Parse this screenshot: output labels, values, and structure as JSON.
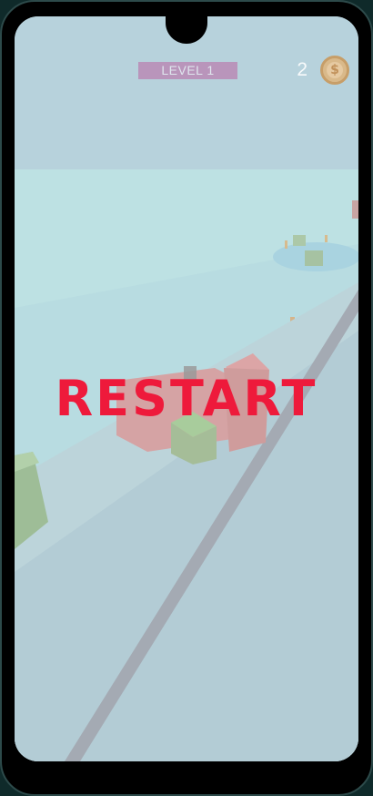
{
  "hud": {
    "level_label": "LEVEL 1",
    "coin_count": "2",
    "coin_icon": "dollar-coin-icon"
  },
  "overlay": {
    "restart_label": "RESTART"
  },
  "colors": {
    "sky": "#b7d2dc",
    "water": "#bde1e3",
    "track": "#c2d9df",
    "rail": "#a5aab4",
    "restart_text": "#ee1a3b",
    "level_badge": "#b995bb",
    "coin": "#d9b98a"
  }
}
